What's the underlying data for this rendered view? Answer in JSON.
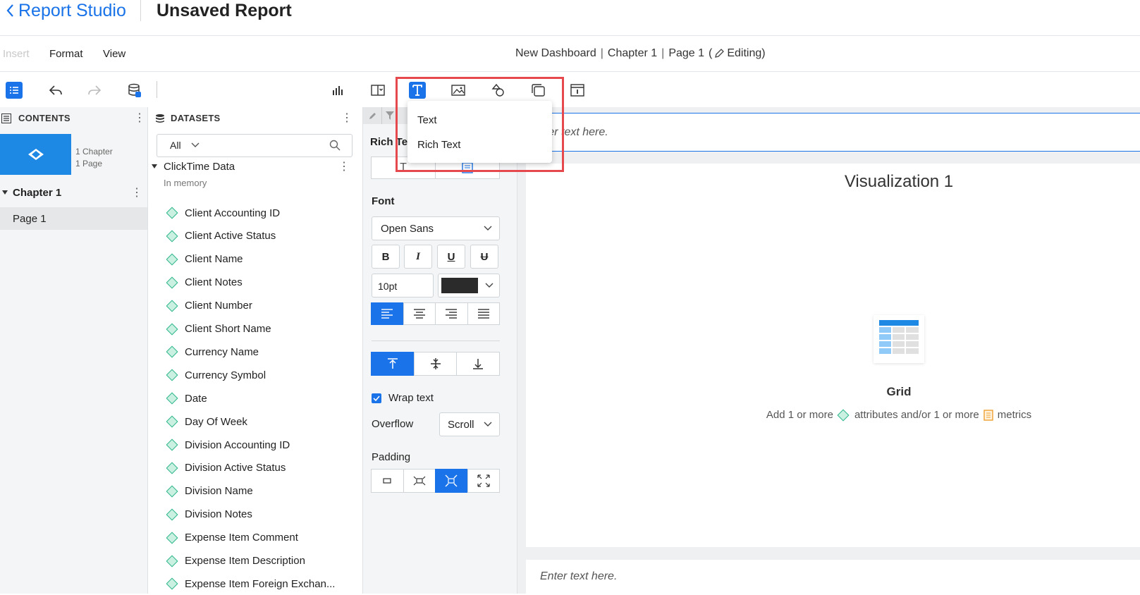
{
  "titlebar": {
    "back_label": "Report Studio",
    "report_title": "Unsaved Report"
  },
  "menu": {
    "items": [
      "Insert",
      "Format",
      "View"
    ]
  },
  "breadcrumb": {
    "dashboard": "New Dashboard",
    "chapter": "Chapter 1",
    "page": "Page 1",
    "state_open": "(",
    "state": "Editing)"
  },
  "contents": {
    "header": "CONTENTS",
    "meta_chapters": "1 Chapter",
    "meta_pages": "1 Page",
    "chapter": "Chapter 1",
    "page": "Page 1"
  },
  "datasets": {
    "header": "DATASETS",
    "filter": "All",
    "dataset_name": "ClickTime Data",
    "dataset_sub": "In memory",
    "attributes": [
      "Client Accounting ID",
      "Client Active Status",
      "Client Name",
      "Client Notes",
      "Client Number",
      "Client Short Name",
      "Currency Name",
      "Currency Symbol",
      "Date",
      "Day Of Week",
      "Division Accounting ID",
      "Division Active Status",
      "Division Name",
      "Division Notes",
      "Expense Item Comment",
      "Expense Item Description",
      "Expense Item Foreign Exchan..."
    ]
  },
  "format_panel": {
    "section_title": "Rich Te",
    "font_label": "Font",
    "font_family": "Open Sans",
    "font_size": "10pt",
    "font_color": "#2b2b2b",
    "wrap_text": "Wrap text",
    "overflow_label": "Overflow",
    "overflow_value": "Scroll",
    "padding_label": "Padding"
  },
  "canvas": {
    "text_placeholder_top": "nter text here.",
    "viz_title": "Visualization 1",
    "empty_title": "Grid",
    "empty_msg_1": "Add 1 or more",
    "empty_msg_2": "attributes and/or 1 or more",
    "empty_msg_3": "metrics",
    "text_placeholder_bottom": "Enter text here."
  },
  "dropdown": {
    "items": [
      "Text",
      "Rich Text"
    ]
  },
  "colors": {
    "accent": "#1a73e8",
    "highlight": "#e5484d",
    "attribute": "#2bb58a",
    "metric": "#f0a030"
  }
}
